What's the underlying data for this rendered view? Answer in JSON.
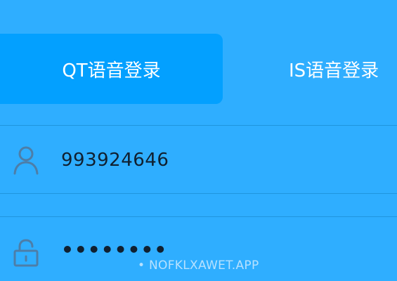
{
  "tabs": [
    {
      "label": "QT语音登录",
      "active": true
    },
    {
      "label": "IS语音登录",
      "active": false
    }
  ],
  "login": {
    "username_value": "993924646",
    "password_masked": "••••••••"
  },
  "icons": {
    "username": "user-icon",
    "password": "lock-icon"
  },
  "watermark": {
    "text": "• NOFKLXAWET.APP"
  },
  "colors": {
    "background": "#2faeff",
    "active_tab": "#03a0ff",
    "text_primary": "#ffffff",
    "field_text": "#102030"
  }
}
